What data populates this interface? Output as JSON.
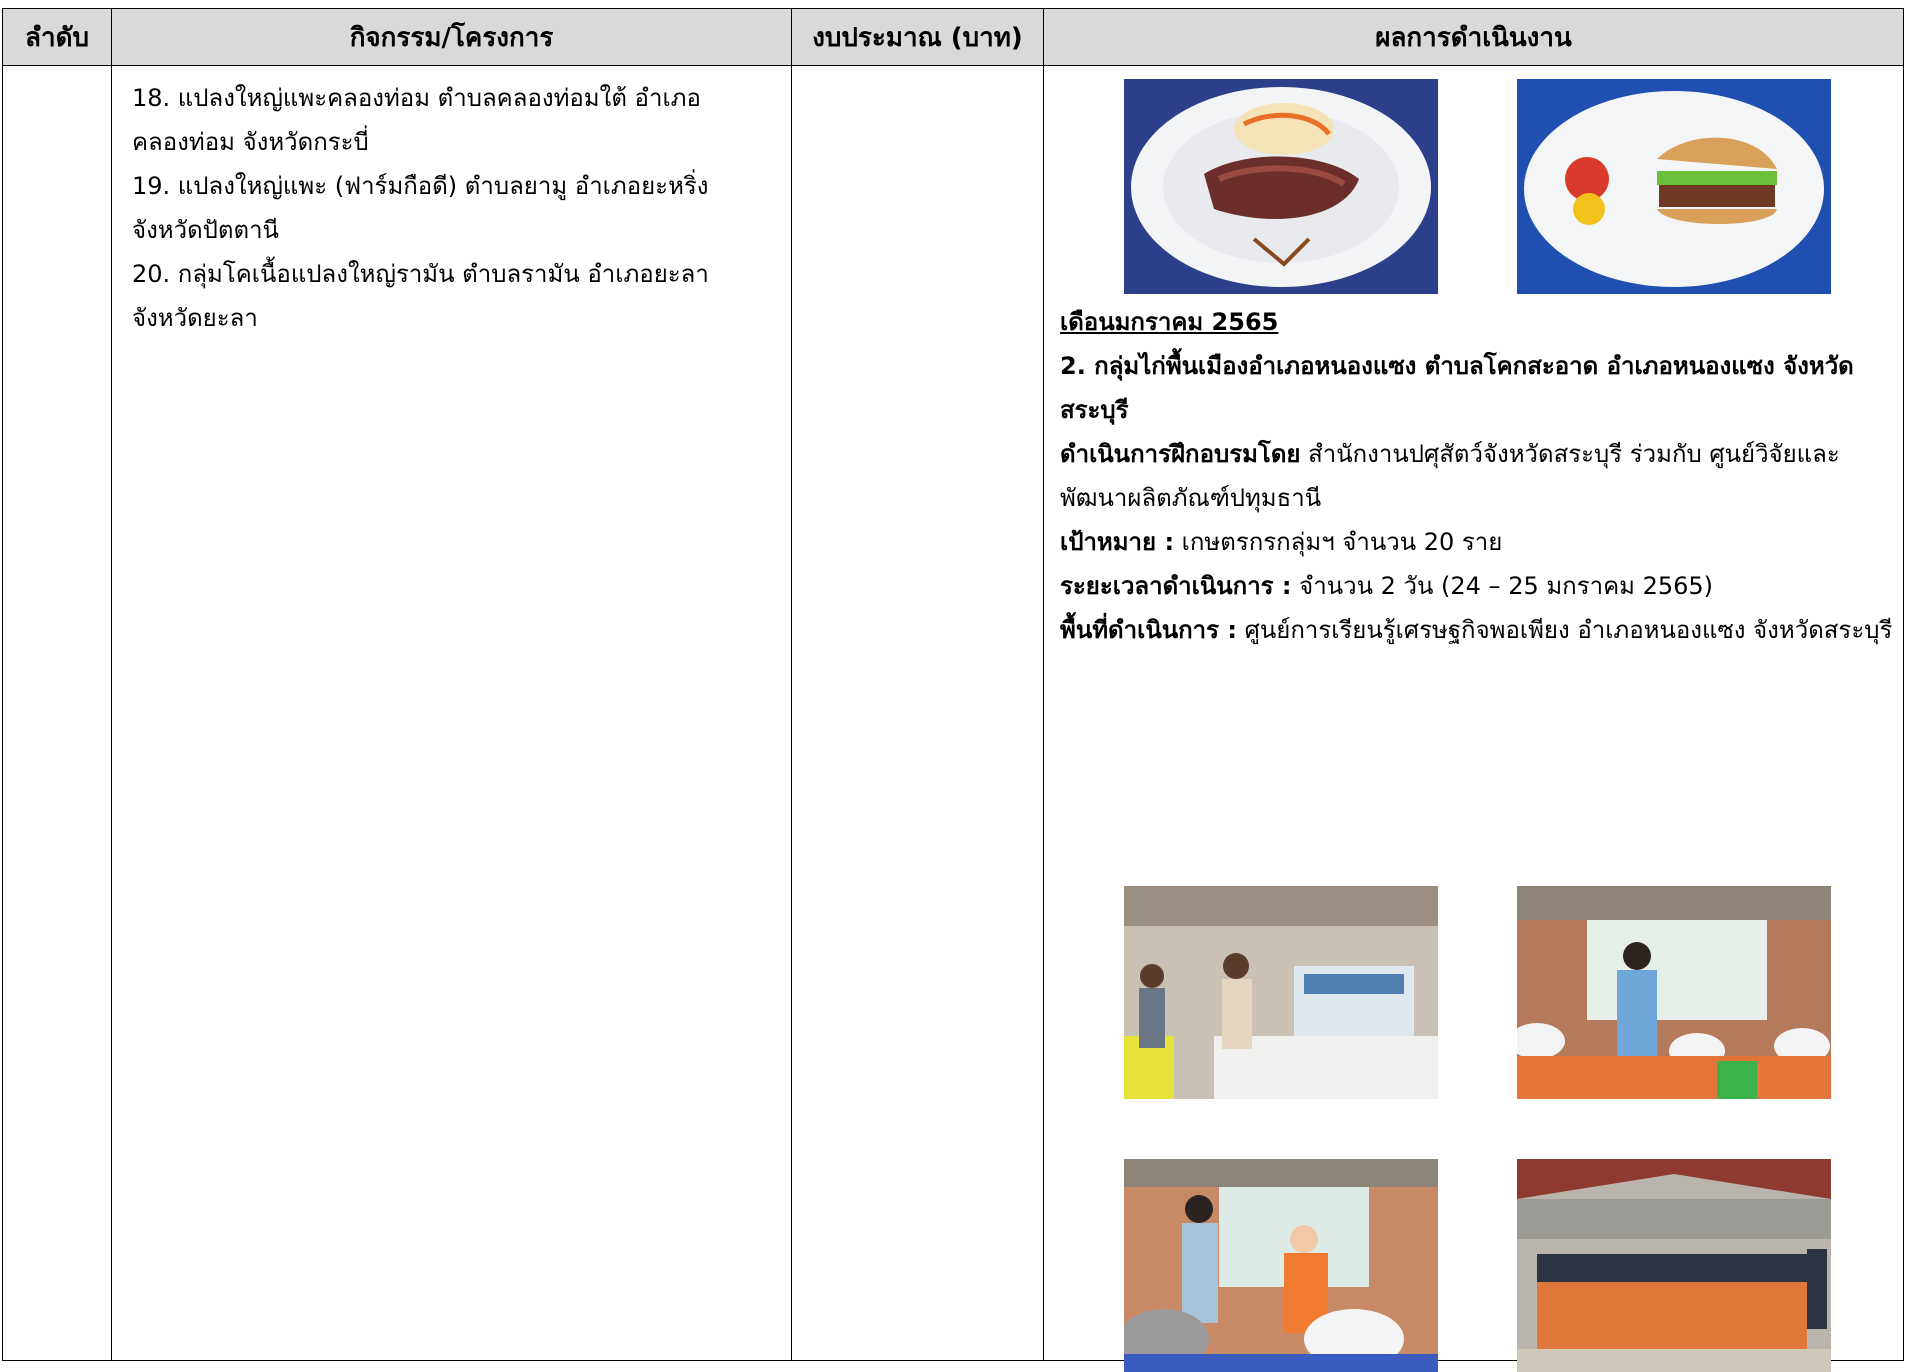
{
  "table": {
    "headers": {
      "order": "ลำดับ",
      "activity": "กิจกรรม/โครงการ",
      "budget": "งบประมาณ (บาท)",
      "results": "ผลการดำเนินงาน"
    }
  },
  "activities": [
    "18. แปลงใหญ่แพะคลองท่อม ตำบลคลองท่อมใต้ อำเภอคลองท่อม จังหวัดกระบี่",
    "19. แปลงใหญ่แพะ (ฟาร์มกือดี) ตำบลยามู อำเภอยะหริ่ง จังหวัดปัตตานี",
    "20. กลุ่มโคเนื้อแปลงใหญ่รามัน ตำบลรามัน อำเภอยะลา จังหวัดยะลา"
  ],
  "results": {
    "month": "เดือนมกราคม 2565",
    "group_title": "2. กลุ่มไก่พื้นเมืองอำเภอหนองแซง ตำบลโคกสะอาด อำเภอหนองแซง จังหวัดสระบุรี",
    "training_label": "ดำเนินการฝึกอบรมโดย",
    "training_value": " สำนักงานปศุสัตว์จังหวัดสระบุรี ร่วมกับ ศูนย์วิจัยและพัฒนาผลิตภัณฑ์ปทุมธานี",
    "target_label": "เป้าหมาย :",
    "target_value": " เกษตรกรกลุ่มฯ จำนวน 20 ราย",
    "period_label": "ระยะเวลาดำเนินการ :",
    "period_value": " จำนวน 2 วัน (24 – 25 มกราคม 2565)",
    "area_label": "พื้นที่ดำเนินการ :",
    "area_value": " ศูนย์การเรียนรู้เศรษฐกิจพอเพียง อำเภอหนองแซง จังหวัดสระบุรี"
  }
}
